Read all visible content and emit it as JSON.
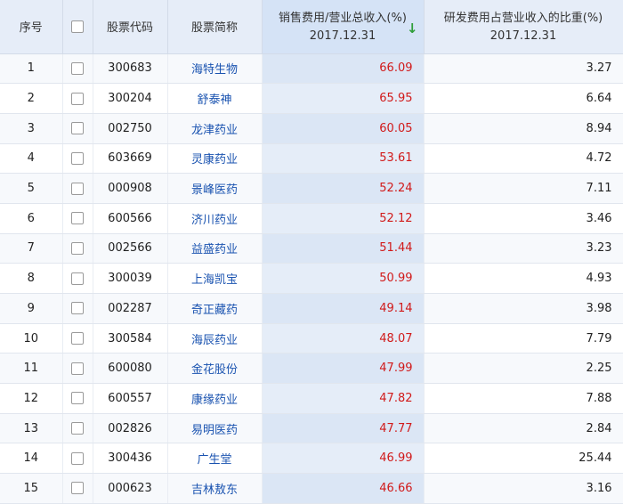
{
  "table": {
    "headers": {
      "no": "序号",
      "code": "股票代码",
      "name": "股票简称",
      "sales_line1": "销售费用/营业总收入(%)",
      "sales_line2": "2017.12.31",
      "sort_indicator": "↓",
      "rd_line1": "研发费用占营业收入的比重(%)",
      "rd_line2": "2017.12.31"
    },
    "rows": [
      {
        "no": "1",
        "code": "300683",
        "name": "海特生物",
        "sales": "66.09",
        "rd": "3.27"
      },
      {
        "no": "2",
        "code": "300204",
        "name": "舒泰神",
        "sales": "65.95",
        "rd": "6.64"
      },
      {
        "no": "3",
        "code": "002750",
        "name": "龙津药业",
        "sales": "60.05",
        "rd": "8.94"
      },
      {
        "no": "4",
        "code": "603669",
        "name": "灵康药业",
        "sales": "53.61",
        "rd": "4.72"
      },
      {
        "no": "5",
        "code": "000908",
        "name": "景峰医药",
        "sales": "52.24",
        "rd": "7.11"
      },
      {
        "no": "6",
        "code": "600566",
        "name": "济川药业",
        "sales": "52.12",
        "rd": "3.46"
      },
      {
        "no": "7",
        "code": "002566",
        "name": "益盛药业",
        "sales": "51.44",
        "rd": "3.23"
      },
      {
        "no": "8",
        "code": "300039",
        "name": "上海凯宝",
        "sales": "50.99",
        "rd": "4.93"
      },
      {
        "no": "9",
        "code": "002287",
        "name": "奇正藏药",
        "sales": "49.14",
        "rd": "3.98"
      },
      {
        "no": "10",
        "code": "300584",
        "name": "海辰药业",
        "sales": "48.07",
        "rd": "7.79"
      },
      {
        "no": "11",
        "code": "600080",
        "name": "金花股份",
        "sales": "47.99",
        "rd": "2.25"
      },
      {
        "no": "12",
        "code": "600557",
        "name": "康缘药业",
        "sales": "47.82",
        "rd": "7.88"
      },
      {
        "no": "13",
        "code": "002826",
        "name": "易明医药",
        "sales": "47.77",
        "rd": "2.84"
      },
      {
        "no": "14",
        "code": "300436",
        "name": "广生堂",
        "sales": "46.99",
        "rd": "25.44"
      },
      {
        "no": "15",
        "code": "000623",
        "name": "吉林敖东",
        "sales": "46.66",
        "rd": "3.16"
      }
    ]
  },
  "colors": {
    "header_bg": "#e6edf8",
    "sorted_column_bg": "#dbe6f5",
    "link_blue": "#1a53b0",
    "value_red": "#d11a1a",
    "sort_arrow_green": "#2f9e3a"
  },
  "icons": {
    "checkbox": "checkbox-icon",
    "sort": "sort-desc-arrow-icon"
  }
}
